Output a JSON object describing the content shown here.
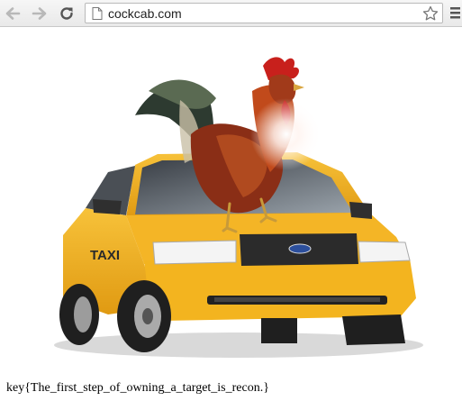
{
  "browser": {
    "url": "cockcab.com",
    "icons": {
      "back": "back-arrow-icon",
      "forward": "forward-arrow-icon",
      "reload": "reload-icon",
      "page": "page-icon",
      "bookmark": "star-icon",
      "menu": "hamburger-menu-icon"
    }
  },
  "hero_image": {
    "taxi_sign": "TAXI",
    "colors": {
      "taxi_yellow": "#f2b318",
      "rooster_red": "#b63a1e"
    }
  },
  "content": {
    "key_text": "key{The_first_step_of_owning_a_target_is_recon.}"
  }
}
